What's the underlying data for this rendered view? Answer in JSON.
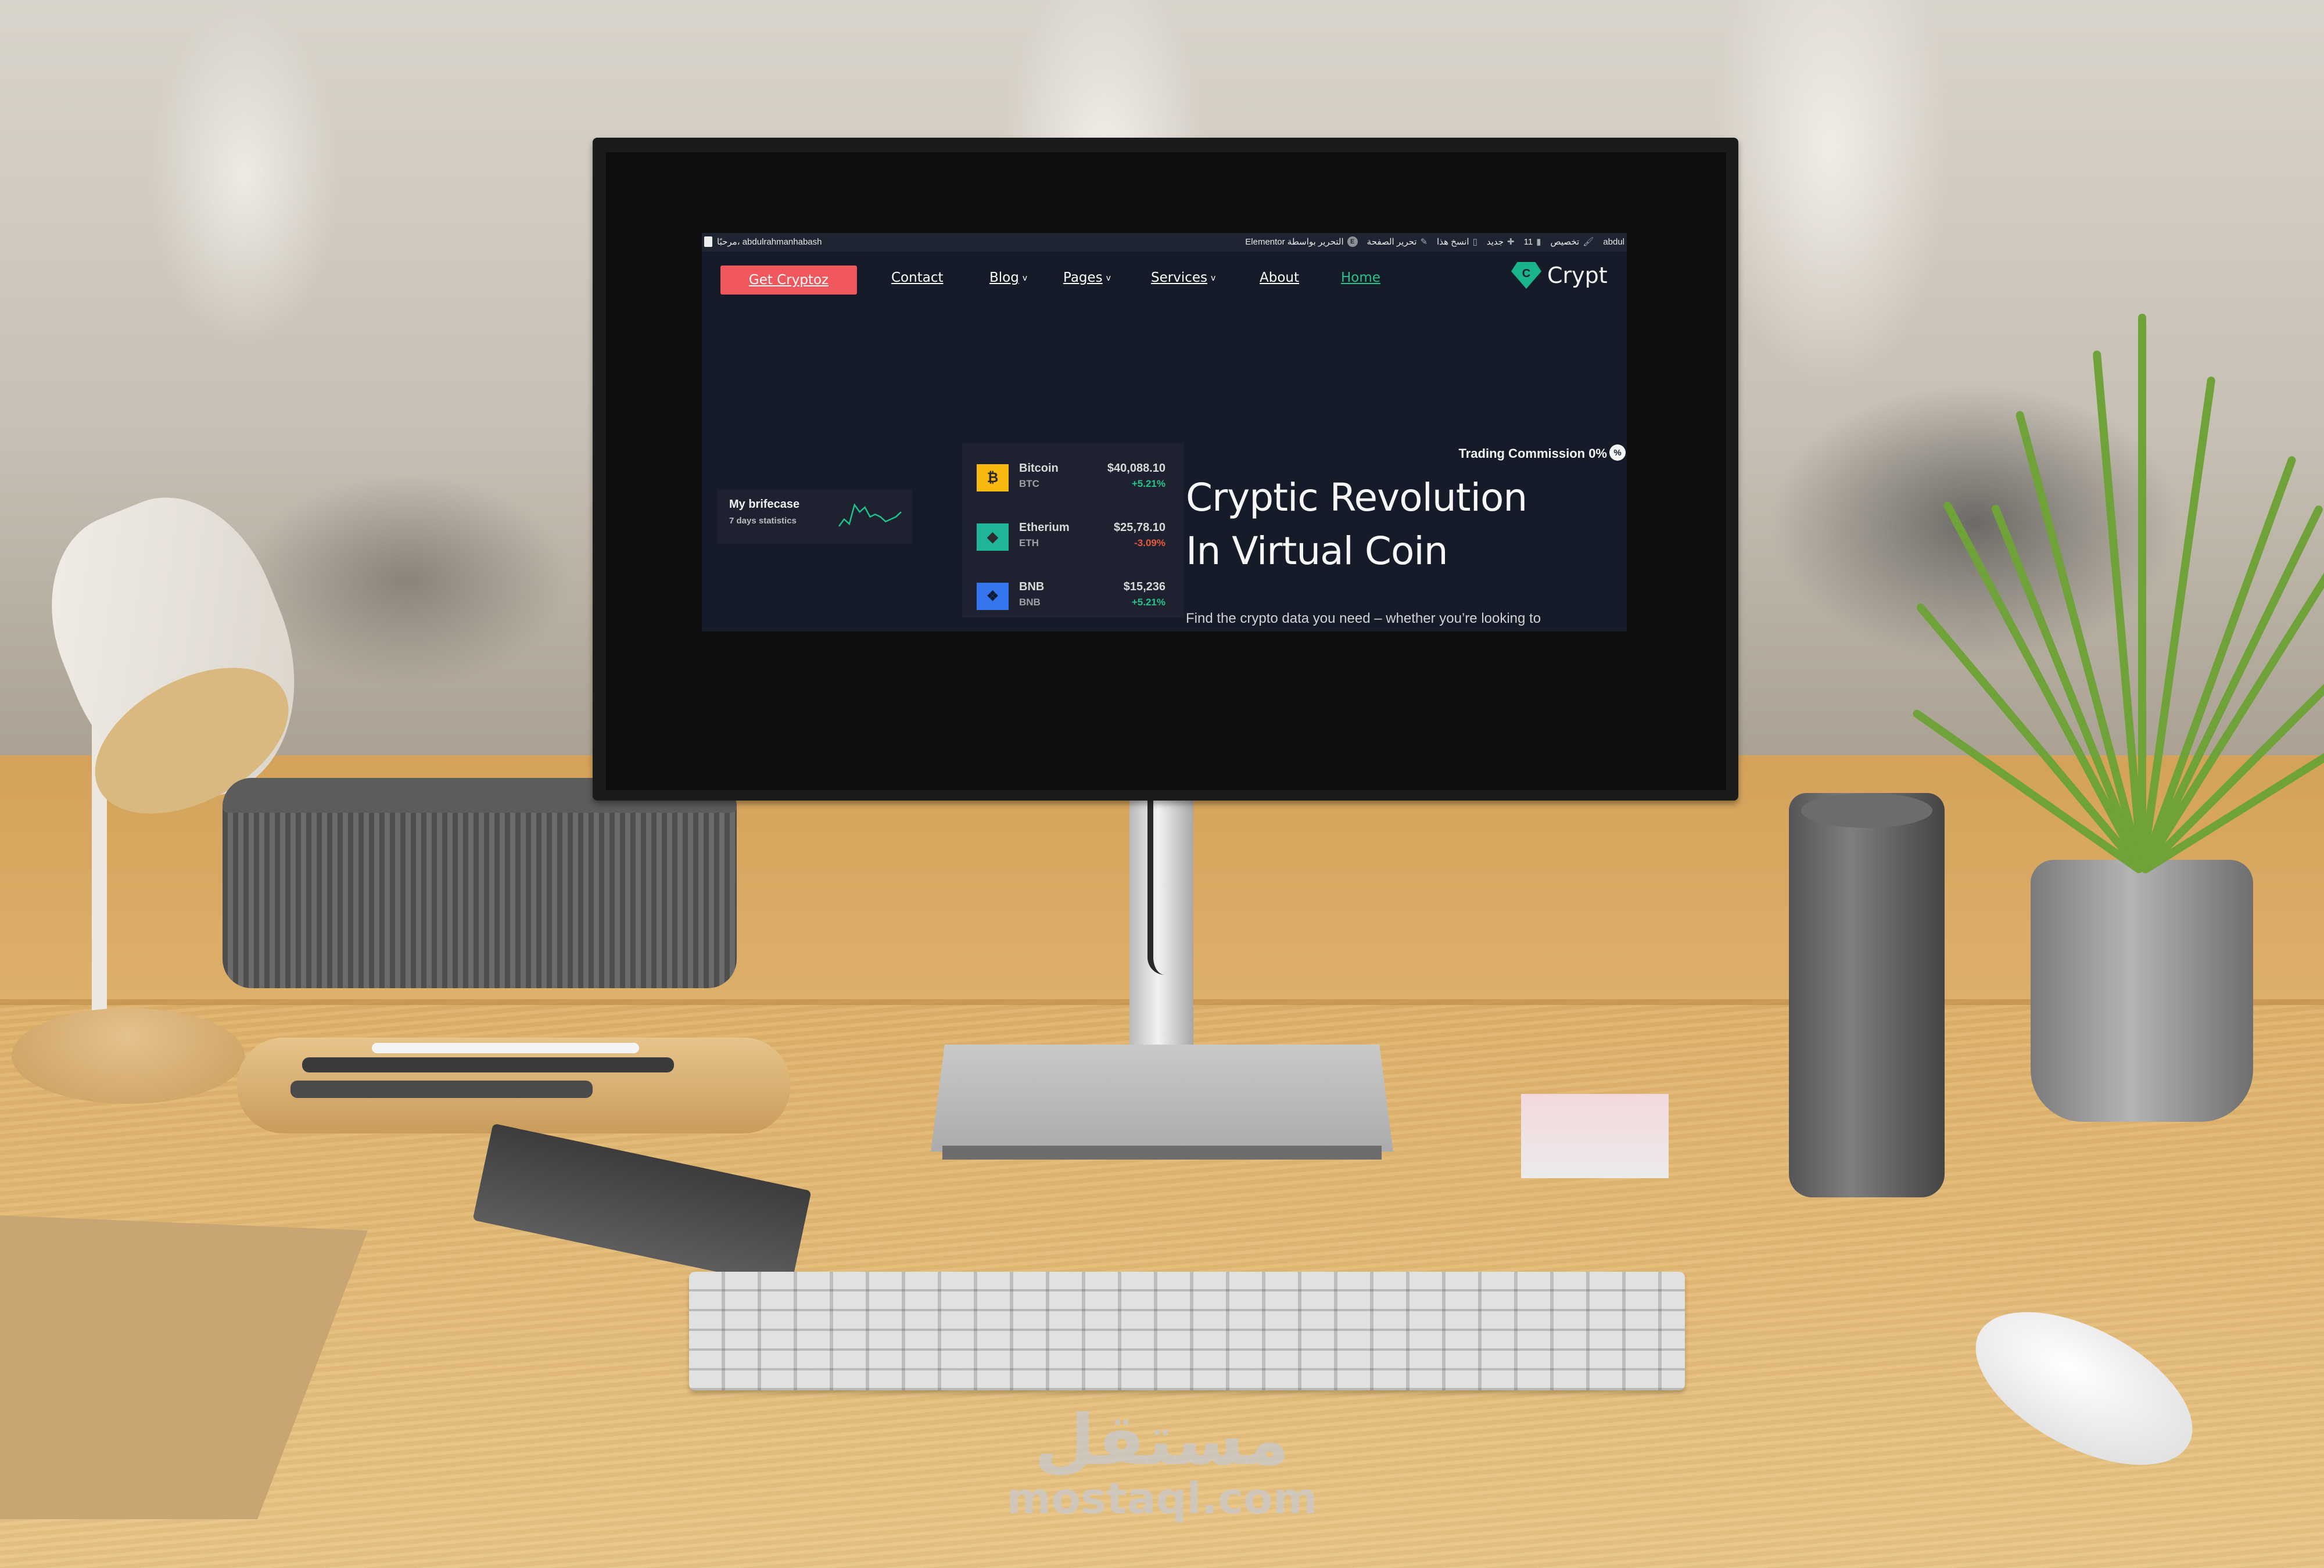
{
  "admin_bar": {
    "greeting": "مرحبًا، abdulrahmanhabash",
    "items": [
      {
        "label": "abdul",
        "icon": "wordpress-icon"
      },
      {
        "label": "تخصيص",
        "icon": "brush-icon"
      },
      {
        "label": "11",
        "icon": "comment-icon"
      },
      {
        "label": "جديد",
        "icon": "plus-icon"
      },
      {
        "label": "انسخ هذا",
        "icon": "copy-icon"
      },
      {
        "label": "تحرير الصفحة",
        "icon": "pencil-icon"
      },
      {
        "label": "التحرير بواسطة Elementor",
        "icon": "elementor-icon"
      }
    ]
  },
  "header": {
    "cta_label": "Get Cryptoz",
    "nav": [
      {
        "label": "Contact",
        "dropdown": false,
        "active": false
      },
      {
        "label": "Blog",
        "dropdown": true,
        "active": false
      },
      {
        "label": "Pages",
        "dropdown": true,
        "active": false
      },
      {
        "label": "Services",
        "dropdown": true,
        "active": false
      },
      {
        "label": "About",
        "dropdown": false,
        "active": false
      },
      {
        "label": "Home",
        "dropdown": false,
        "active": true
      }
    ],
    "logo_letter": "C",
    "logo_text": "Crypt"
  },
  "briefcase": {
    "title": "My brifecase",
    "subtitle": "7 days statistics",
    "sparkline": [
      3,
      6,
      4,
      12,
      9,
      11,
      7,
      8,
      7,
      5,
      6,
      7,
      9
    ]
  },
  "coins": [
    {
      "name": "Bitcoin",
      "symbol": "BTC",
      "price": "$40,088.10",
      "change": "+5.21%",
      "trend": "up",
      "icon_glyph": "₿",
      "icon_bg": "#f7b90f"
    },
    {
      "name": "Etherium",
      "symbol": "ETH",
      "price": "$25,78.10",
      "change": "-3.09%",
      "trend": "down",
      "icon_glyph": "◆",
      "icon_bg": "#1eb598"
    },
    {
      "name": "BNB",
      "symbol": "BNB",
      "price": "$15,236",
      "change": "+5.21%",
      "trend": "up",
      "icon_glyph": "❖",
      "icon_bg": "#3576ee"
    }
  ],
  "hero": {
    "commission": "Trading Commission 0%",
    "commission_badge": "%",
    "title_line1": "Cryptic Revolution",
    "title_line2": "In Virtual Coin",
    "description": "Find the crypto data you need – whether you’re looking to"
  },
  "colors": {
    "page_bg": "#161b29",
    "card_bg": "#1e2230",
    "accent_red": "#f0575c",
    "accent_green": "#27c28a",
    "negative": "#e8583d"
  },
  "watermark": {
    "arabic": "مستقل",
    "latin": "mostaql.com"
  }
}
